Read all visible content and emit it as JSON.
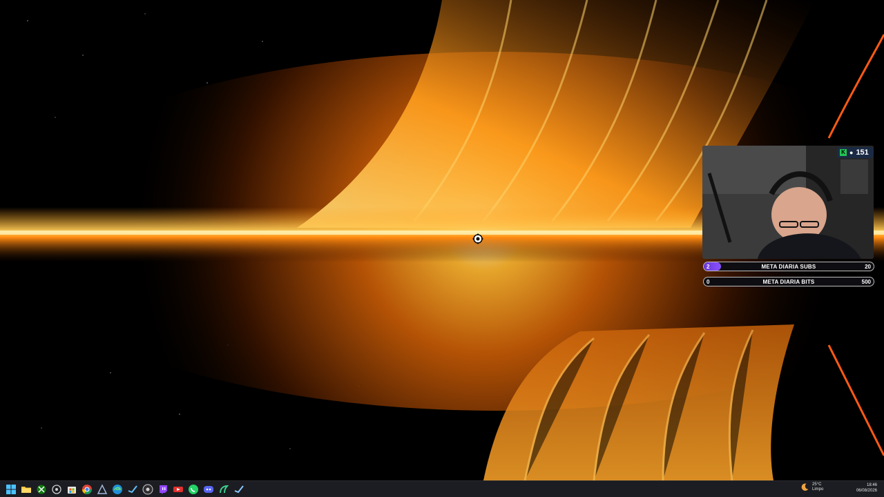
{
  "desktop": {
    "wallpaper": "black-hole-accretion-disk"
  },
  "stream_overlay": {
    "viewer_count": "151",
    "goals": [
      {
        "current": "2",
        "title": "META DIARIA SUBS",
        "max": "20",
        "progress": 0.1,
        "fill_color": "#7a45f0"
      },
      {
        "current": "0",
        "title": "META DIARIA BITS",
        "max": "500",
        "progress": 0.0,
        "fill_color": "#7a45f0"
      }
    ]
  },
  "taskbar": {
    "icons": [
      "windows-start-icon",
      "file-explorer-icon",
      "xbox-icon",
      "system-icon",
      "chrome-icon",
      "store-icon",
      "app-icon",
      "edge-icon",
      "steam-icon",
      "obs-icon",
      "twitch-icon",
      "remote-icon",
      "whatsapp-icon",
      "discord-icon",
      "app-icon",
      "steam-icon"
    ],
    "weather": {
      "temp": "25°C",
      "cond": "Limpo"
    },
    "clock": {
      "time": "18:46",
      "date": "06/08/2026"
    }
  }
}
